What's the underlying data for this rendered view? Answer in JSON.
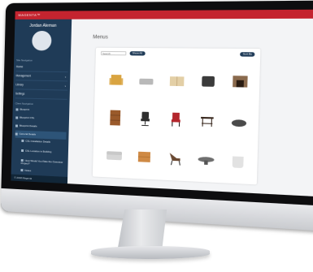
{
  "app": {
    "brand": "MAGENTA™"
  },
  "user": {
    "name": "Jordan Aleman"
  },
  "sidebar": {
    "section_site": "Site Navigation",
    "items": [
      {
        "label": "Home",
        "chevron": false
      },
      {
        "label": "Management",
        "chevron": true
      },
      {
        "label": "Library",
        "chevron": true
      },
      {
        "label": "Settings",
        "chevron": false
      }
    ],
    "section_client": "Client Navigation",
    "tree": [
      {
        "label": "Blueprint",
        "indent": false,
        "active": false
      },
      {
        "label": "Blueprint CSL",
        "indent": false,
        "active": false
      },
      {
        "label": "Blueprint Details",
        "indent": false,
        "active": false
      },
      {
        "label": "General Details",
        "indent": false,
        "active": true
      },
      {
        "label": "CSL Installation Details",
        "indent": true,
        "active": false
      },
      {
        "label": "CSL Location in Building",
        "indent": true,
        "active": false
      },
      {
        "label": "How Would You Rate the Overview Project?",
        "indent": true,
        "active": false
      },
      {
        "label": "Notes",
        "indent": true,
        "active": false
      }
    ],
    "footer": "© 2018 Magenta"
  },
  "main": {
    "title": "Menus",
    "search_placeholder": "Search",
    "filter_button": "Show All",
    "sort_button": "Sort By"
  },
  "products": [
    {
      "name": "armchair",
      "color": "#d9a441"
    },
    {
      "name": "ottoman",
      "color": "#b9b9b9"
    },
    {
      "name": "cabinet",
      "color": "#e3cfa6"
    },
    {
      "name": "club-chair",
      "color": "#3b3b3b"
    },
    {
      "name": "fireplace",
      "color": "#8a6a4d"
    },
    {
      "name": "dresser",
      "color": "#9a5a2b"
    },
    {
      "name": "office-chair",
      "color": "#2f2f2f"
    },
    {
      "name": "dining-chair",
      "color": "#b3262c"
    },
    {
      "name": "side-table",
      "color": "#3a2a20"
    },
    {
      "name": "pouf",
      "color": "#4a4a4a"
    },
    {
      "name": "sofa",
      "color": "#d6d6d6"
    },
    {
      "name": "wood-cube",
      "color": "#cf8a45"
    },
    {
      "name": "lounge-chair",
      "color": "#6b4a33"
    },
    {
      "name": "coffee-table",
      "color": "#6f6f6f"
    },
    {
      "name": "tub-chair",
      "color": "#e2e2e2"
    }
  ]
}
